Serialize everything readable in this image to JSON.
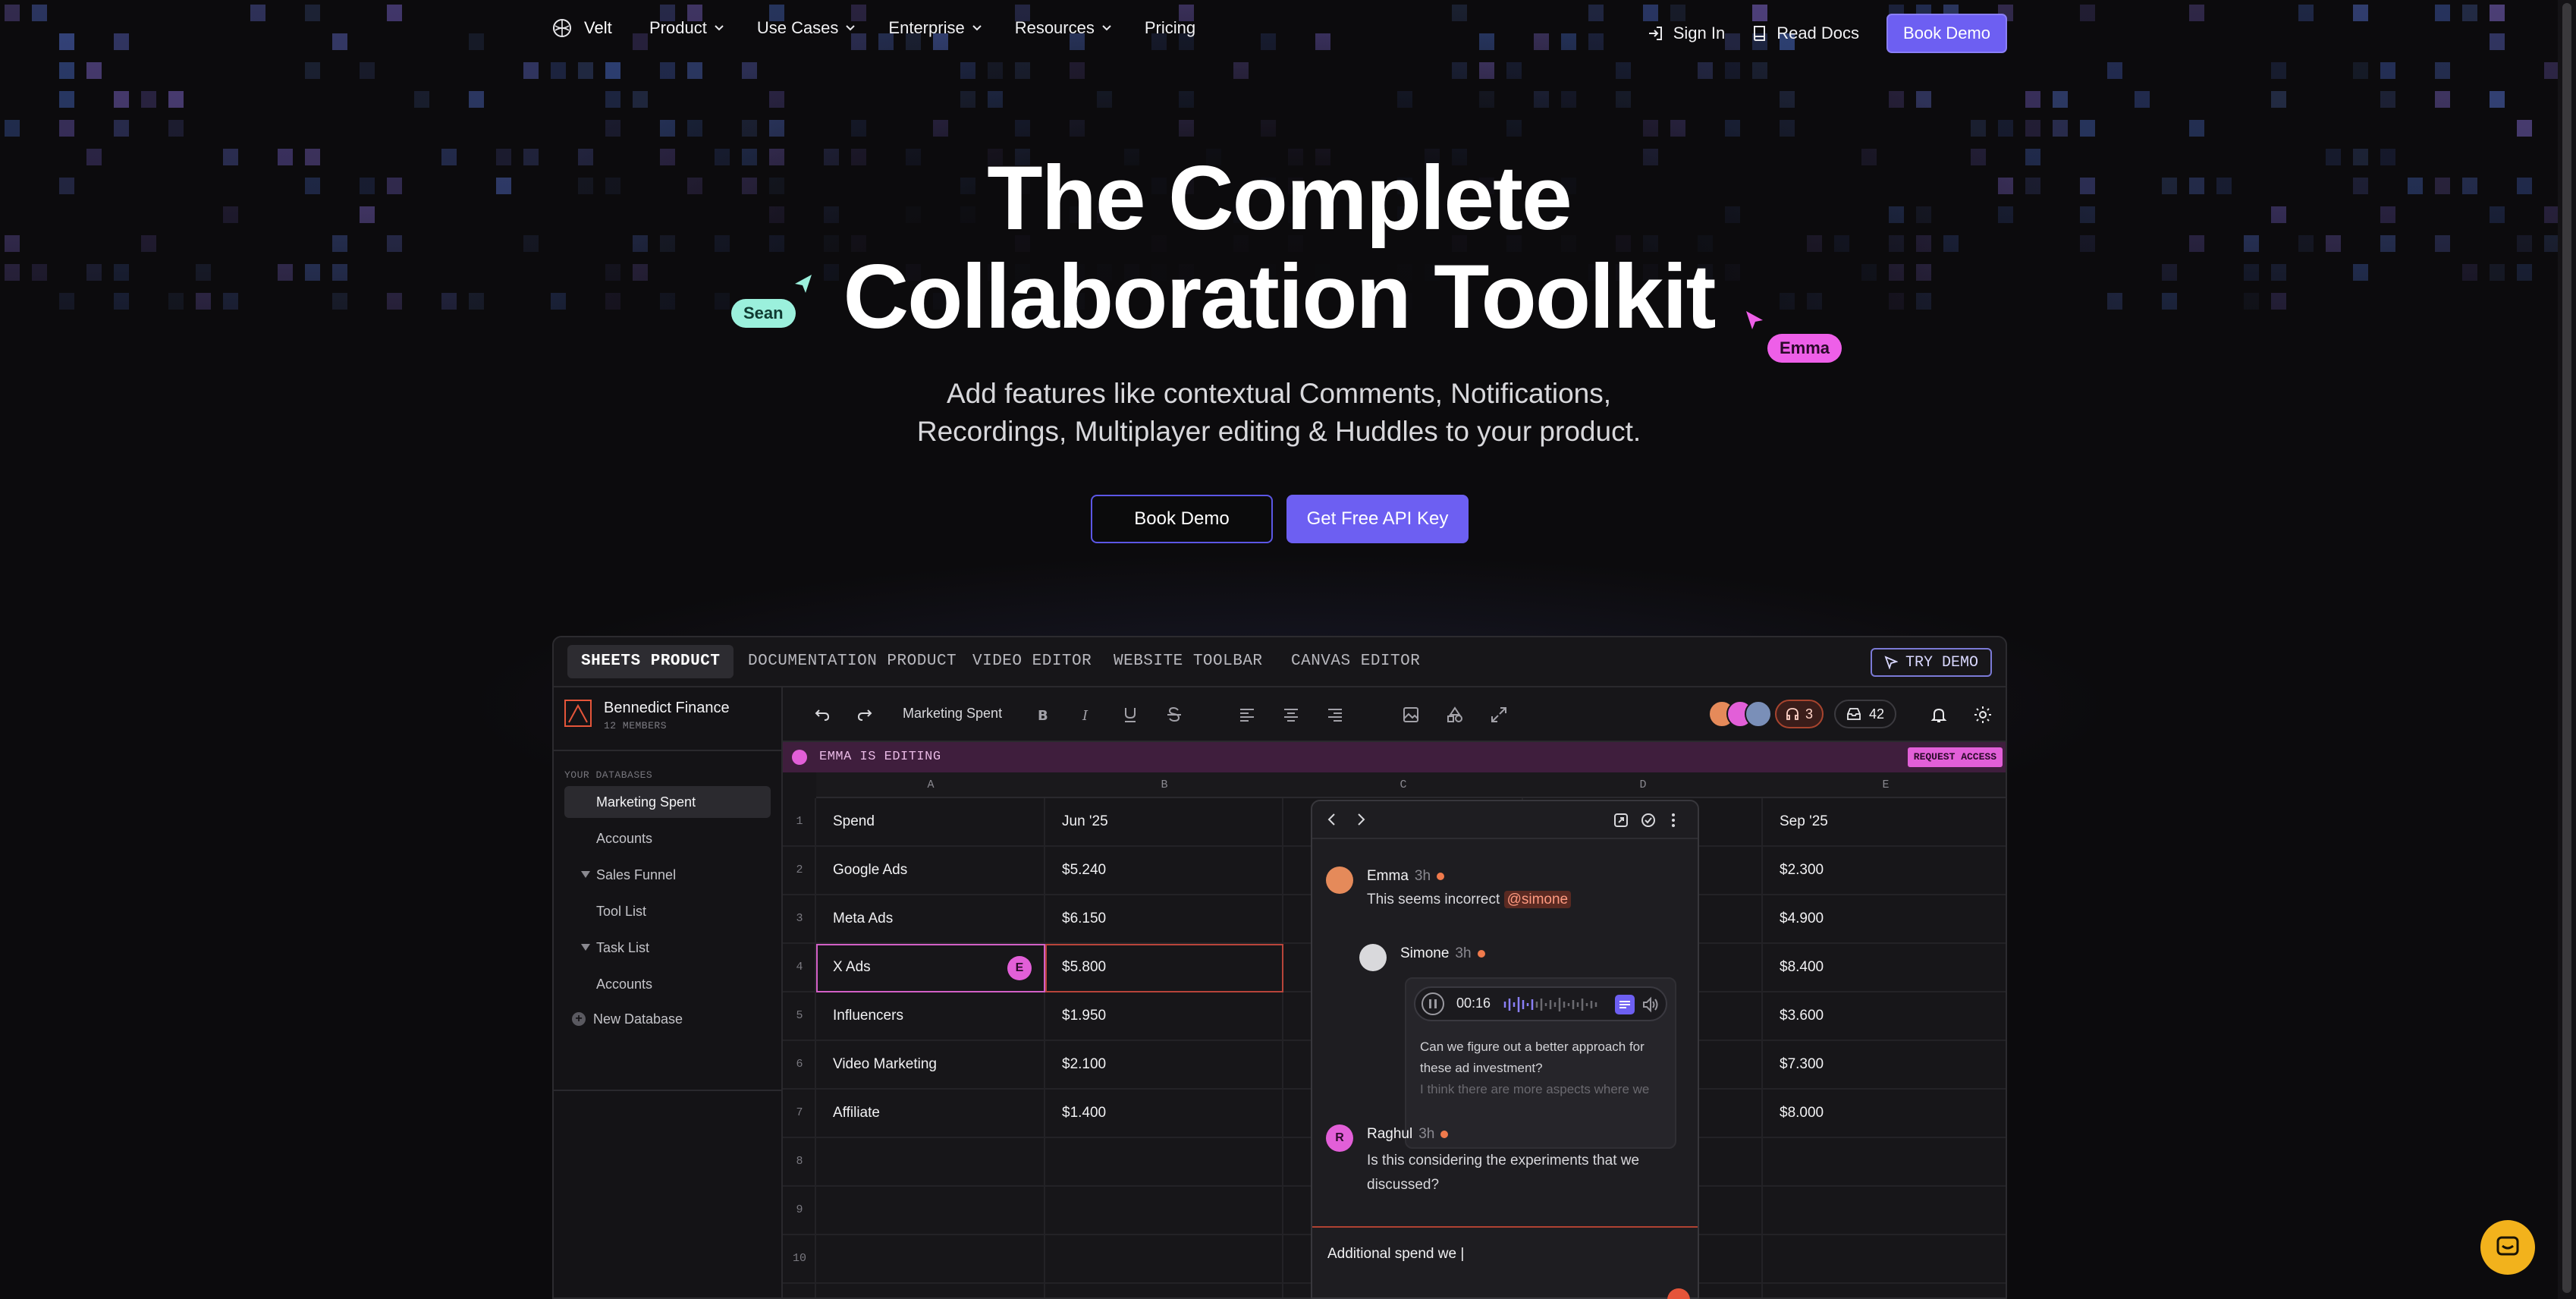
{
  "nav": {
    "brand": "Velt",
    "menu": [
      {
        "label": "Product",
        "has_dropdown": true
      },
      {
        "label": "Use Cases",
        "has_dropdown": true
      },
      {
        "label": "Enterprise",
        "has_dropdown": true
      },
      {
        "label": "Resources",
        "has_dropdown": true
      },
      {
        "label": "Pricing",
        "has_dropdown": false
      }
    ],
    "sign_in": "Sign In",
    "read_docs": "Read Docs",
    "book_demo": "Book Demo"
  },
  "hero": {
    "title_line1": "The Complete",
    "title_line2": "Collaboration Toolkit",
    "subtitle_line1": "Add features like contextual Comments, Notifications,",
    "subtitle_line2": "Recordings, Multiplayer editing & Huddles to your product.",
    "btn_book_demo": "Book Demo",
    "btn_api_key": "Get Free API Key",
    "cursor_sean": "Sean",
    "cursor_emma": "Emma"
  },
  "demo": {
    "tabs": [
      "SHEETS PRODUCT",
      "DOCUMENTATION PRODUCT",
      "VIDEO EDITOR",
      "WEBSITE TOOLBAR",
      "CANVAS EDITOR"
    ],
    "active_tab": 0,
    "try_demo": "TRY DEMO",
    "workspace": {
      "name": "Bennedict Finance",
      "members": "12 MEMBERS"
    },
    "sidebar_label": "YOUR DATABASES",
    "sidebar_items": [
      {
        "label": "Marketing Spent",
        "active": true,
        "type": "item"
      },
      {
        "label": "Accounts",
        "type": "item"
      },
      {
        "label": "Sales Funnel",
        "type": "group"
      },
      {
        "label": "Tool List",
        "type": "item"
      },
      {
        "label": "Task List",
        "type": "group"
      },
      {
        "label": "Accounts",
        "type": "item"
      },
      {
        "label": "New Database",
        "type": "add"
      }
    ],
    "sheet_name": "Marketing Spent",
    "huddle_count": "3",
    "inbox_count": "42",
    "banner": "EMMA IS EDITING",
    "request_access": "REQUEST ACCESS",
    "columns": [
      "A",
      "B",
      "C",
      "D",
      "E"
    ],
    "rows": [
      {
        "num": "1",
        "a": "Spend",
        "b": "Jun '25",
        "e": "Sep '25"
      },
      {
        "num": "2",
        "a": "Google Ads",
        "b": "$5.240",
        "e": "$2.300"
      },
      {
        "num": "3",
        "a": "Meta Ads",
        "b": "$6.150",
        "e": "$4.900"
      },
      {
        "num": "4",
        "a": "X Ads",
        "b": "$5.800",
        "e": "$8.400"
      },
      {
        "num": "5",
        "a": "Influencers",
        "b": "$1.950",
        "e": "$3.600"
      },
      {
        "num": "6",
        "a": "Video Marketing",
        "b": "$2.100",
        "e": "$7.300"
      },
      {
        "num": "7",
        "a": "Affiliate",
        "b": "$1.400",
        "e": "$8.000"
      },
      {
        "num": "8",
        "a": "",
        "b": "",
        "e": ""
      },
      {
        "num": "9",
        "a": "",
        "b": "",
        "e": ""
      },
      {
        "num": "10",
        "a": "",
        "b": "",
        "e": ""
      }
    ],
    "editing_badge": "E",
    "comments": {
      "c1": {
        "name": "Emma",
        "time": "3h",
        "text": "This seems incorrect",
        "mention": "@simone"
      },
      "c2": {
        "name": "Simone",
        "time": "3h",
        "voice_time": "00:16",
        "transcript": "Can we figure out a better approach for these ad investment?",
        "transcript_fade": "I think there are more aspects where we"
      },
      "c3": {
        "name": "Raghul",
        "initial": "R",
        "time": "3h",
        "text": "Is this considering the experiments that we discussed?"
      },
      "input": "Additional spend we |"
    }
  },
  "colors": {
    "accent": "#6d5ff2",
    "emma": "#e25fd8",
    "sean": "#9bf0dc",
    "alert": "#f07a4c",
    "chat": "#f2b21c"
  }
}
